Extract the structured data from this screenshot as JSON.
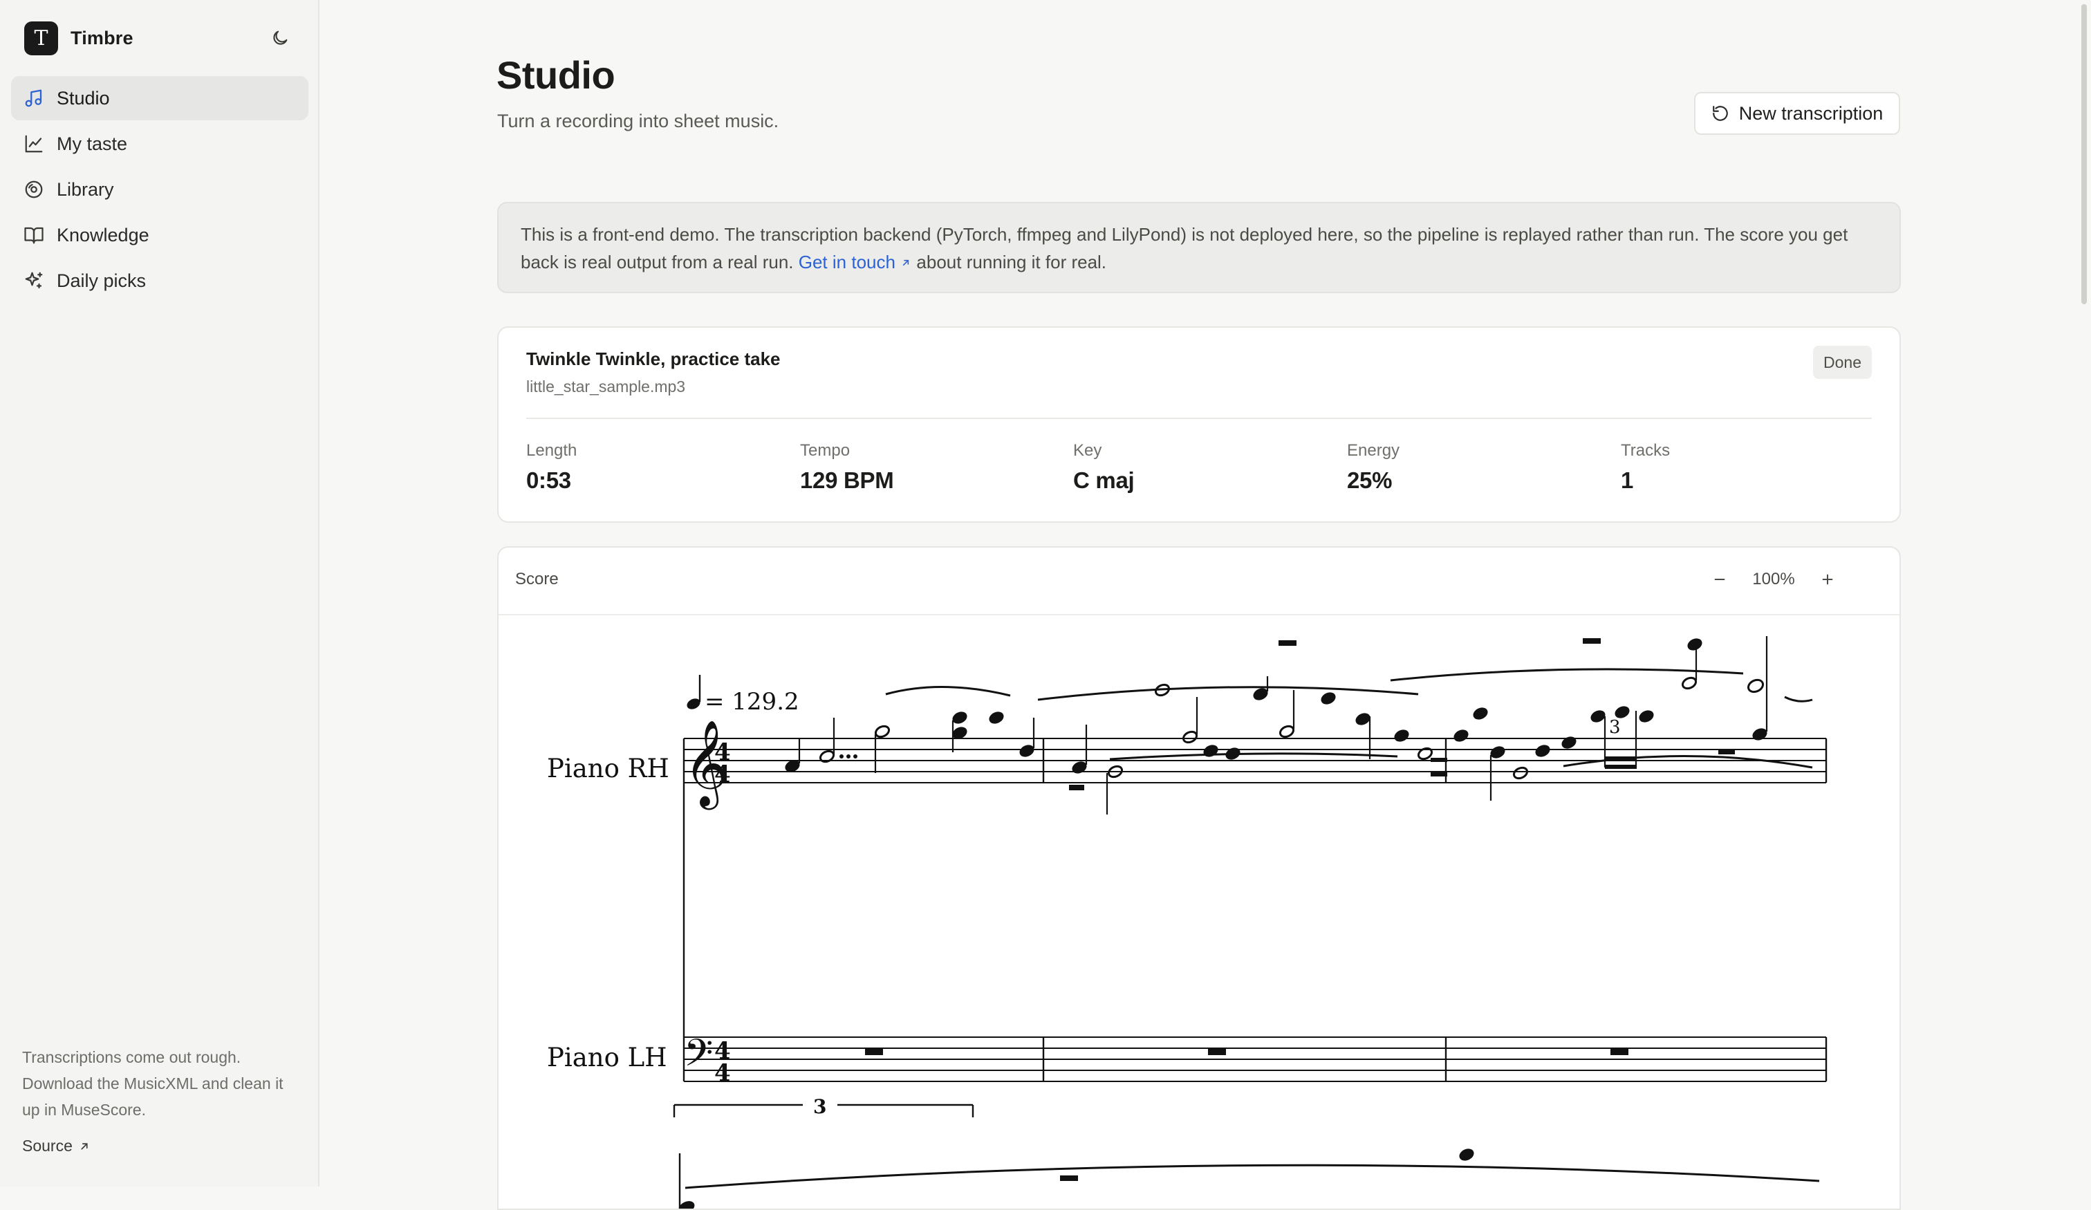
{
  "app": {
    "name": "Timbre",
    "logo_letter": "T"
  },
  "sidebar": {
    "items": [
      {
        "label": "Studio",
        "icon": "music-note-icon",
        "active": true
      },
      {
        "label": "My taste",
        "icon": "line-chart-icon"
      },
      {
        "label": "Library",
        "icon": "disc-icon"
      },
      {
        "label": "Knowledge",
        "icon": "book-icon"
      },
      {
        "label": "Daily picks",
        "icon": "sparkles-icon"
      }
    ],
    "footer_note": "Transcriptions come out rough. Download the MusicXML and clean it up in MuseScore.",
    "source_label": "Source"
  },
  "header": {
    "title": "Studio",
    "subtitle": "Turn a recording into sheet music.",
    "new_button": "New transcription"
  },
  "notice": {
    "text_before": "This is a front-end demo. The transcription backend (PyTorch, ffmpeg and LilyPond) is not deployed here, so the pipeline is replayed rather than run. The score you get back is real output from a real run. ",
    "link_label": "Get in touch",
    "text_after": " about running it for real."
  },
  "track": {
    "title": "Twinkle Twinkle, practice take",
    "file": "little_star_sample.mp3",
    "status": "Done",
    "stats": [
      {
        "label": "Length",
        "value": "0:53"
      },
      {
        "label": "Tempo",
        "value": "129 BPM"
      },
      {
        "label": "Key",
        "value": "C maj"
      },
      {
        "label": "Energy",
        "value": "25%"
      },
      {
        "label": "Tracks",
        "value": "1"
      }
    ]
  },
  "score": {
    "label": "Score",
    "zoom": "100%",
    "tempo_mark": "= 129.2",
    "time_signature": "4/4",
    "staves": [
      "Piano RH",
      "Piano LH"
    ],
    "tuplet_number": "3"
  },
  "colors": {
    "accent": "#2c62d3",
    "text": "#1c1c1a",
    "muted": "#6f6f6b"
  }
}
